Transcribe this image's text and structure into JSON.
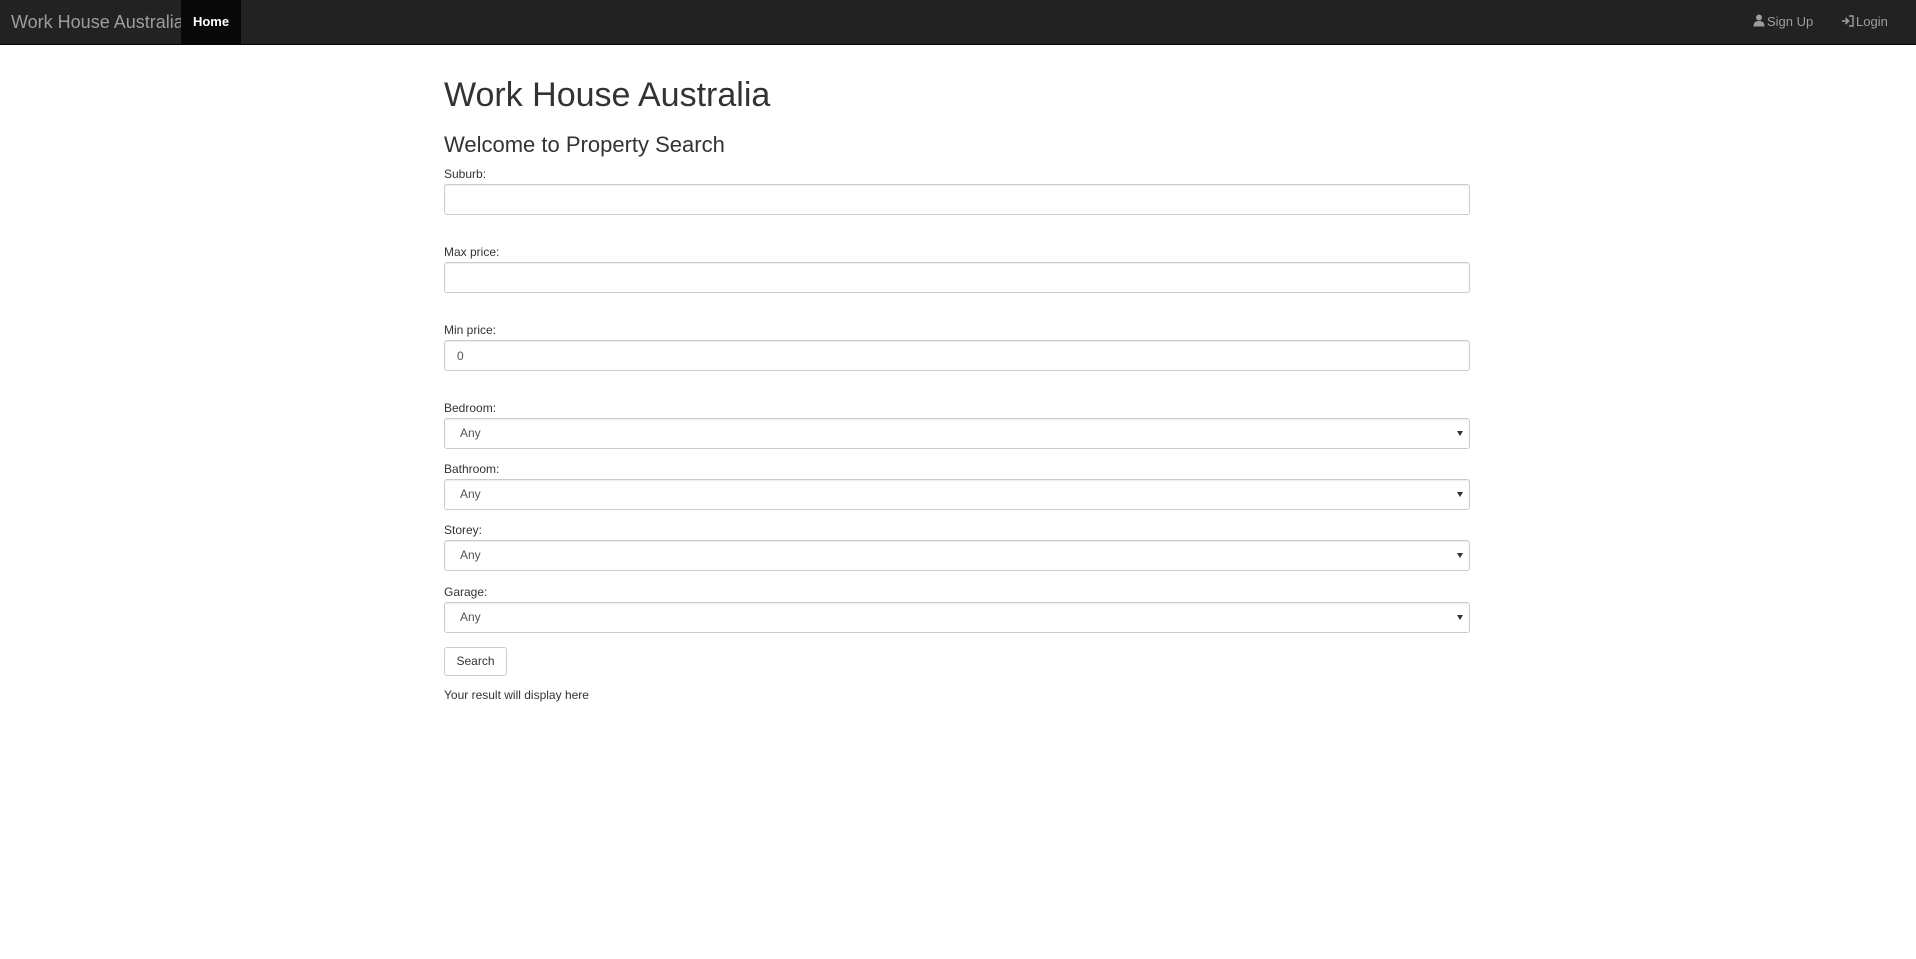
{
  "navbar": {
    "brand": "Work House Australia",
    "home_label": "Home",
    "signup_label": "Sign Up",
    "login_label": "Login",
    "signup_icon": "user-icon",
    "login_icon": "login-icon",
    "background_color": "#222222",
    "active_color": "#080808"
  },
  "main": {
    "title": "Work House Australia",
    "subtitle": "Welcome to Property Search",
    "fields": {
      "suburb": {
        "label": "Suburb:",
        "value": ""
      },
      "max_price": {
        "label": "Max price:",
        "value": ""
      },
      "min_price": {
        "label": "Min price:",
        "value": "0"
      }
    },
    "selects": {
      "bedroom": {
        "label": "Bedroom:",
        "value": "Any"
      },
      "bathroom": {
        "label": "Bathroom:",
        "value": "Any"
      },
      "storey": {
        "label": "Storey:",
        "value": "Any"
      },
      "garage": {
        "label": "Garage:",
        "value": "Any"
      }
    },
    "search_label": "Search",
    "result_text": "Your result will display here"
  }
}
